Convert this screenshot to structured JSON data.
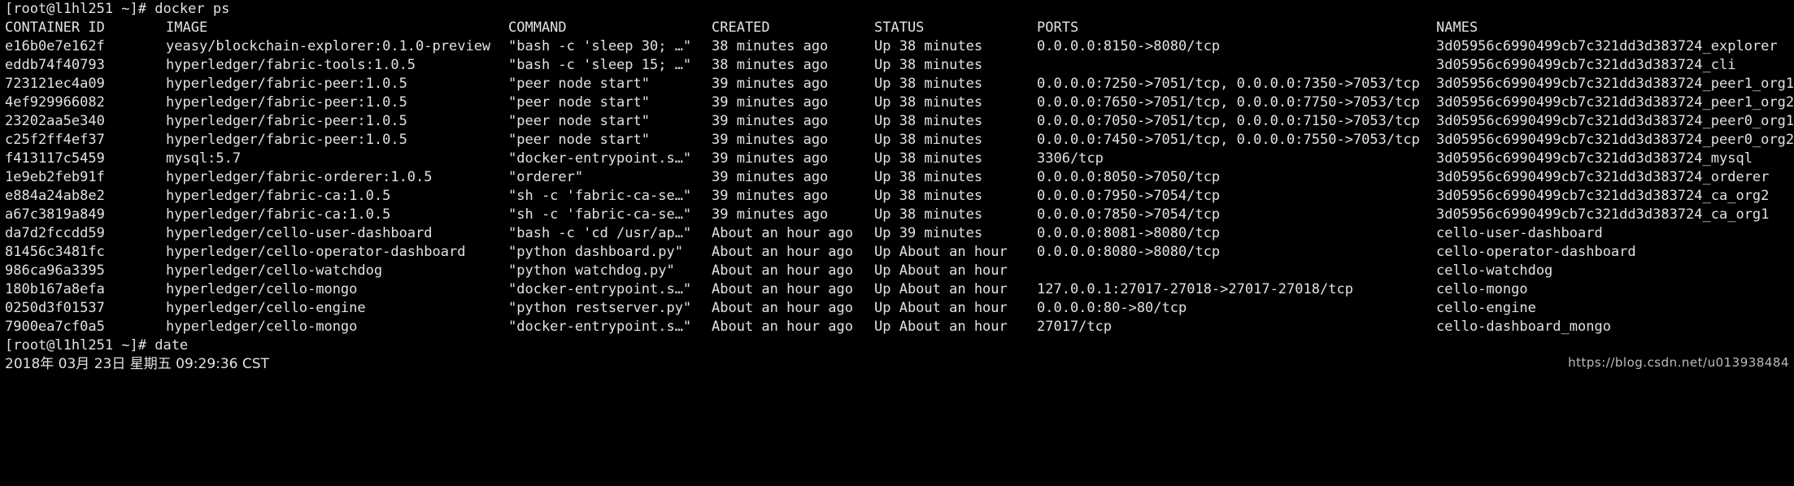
{
  "prompt1": "[root@l1hl251 ~]# docker ps",
  "headers": {
    "id": "CONTAINER ID",
    "image": "IMAGE",
    "command": "COMMAND",
    "created": "CREATED",
    "status": "STATUS",
    "ports": "PORTS",
    "names": "NAMES"
  },
  "rows": [
    {
      "id": "e16b0e7e162f",
      "image": "yeasy/blockchain-explorer:0.1.0-preview",
      "command": "\"bash -c 'sleep 30; …\"",
      "created": "38 minutes ago",
      "status": "Up 38 minutes",
      "ports": "0.0.0.0:8150->8080/tcp",
      "names": "3d05956c6990499cb7c321dd3d383724_explorer"
    },
    {
      "id": "eddb74f40793",
      "image": "hyperledger/fabric-tools:1.0.5",
      "command": "\"bash -c 'sleep 15; …\"",
      "created": "38 minutes ago",
      "status": "Up 38 minutes",
      "ports": "",
      "names": "3d05956c6990499cb7c321dd3d383724_cli"
    },
    {
      "id": "723121ec4a09",
      "image": "hyperledger/fabric-peer:1.0.5",
      "command": "\"peer node start\"",
      "created": "39 minutes ago",
      "status": "Up 38 minutes",
      "ports": "0.0.0.0:7250->7051/tcp, 0.0.0.0:7350->7053/tcp",
      "names": "3d05956c6990499cb7c321dd3d383724_peer1_org1"
    },
    {
      "id": "4ef929966082",
      "image": "hyperledger/fabric-peer:1.0.5",
      "command": "\"peer node start\"",
      "created": "39 minutes ago",
      "status": "Up 38 minutes",
      "ports": "0.0.0.0:7650->7051/tcp, 0.0.0.0:7750->7053/tcp",
      "names": "3d05956c6990499cb7c321dd3d383724_peer1_org2"
    },
    {
      "id": "23202aa5e340",
      "image": "hyperledger/fabric-peer:1.0.5",
      "command": "\"peer node start\"",
      "created": "39 minutes ago",
      "status": "Up 38 minutes",
      "ports": "0.0.0.0:7050->7051/tcp, 0.0.0.0:7150->7053/tcp",
      "names": "3d05956c6990499cb7c321dd3d383724_peer0_org1"
    },
    {
      "id": "c25f2ff4ef37",
      "image": "hyperledger/fabric-peer:1.0.5",
      "command": "\"peer node start\"",
      "created": "39 minutes ago",
      "status": "Up 38 minutes",
      "ports": "0.0.0.0:7450->7051/tcp, 0.0.0.0:7550->7053/tcp",
      "names": "3d05956c6990499cb7c321dd3d383724_peer0_org2"
    },
    {
      "id": "f413117c5459",
      "image": "mysql:5.7",
      "command": "\"docker-entrypoint.s…\"",
      "created": "39 minutes ago",
      "status": "Up 38 minutes",
      "ports": "3306/tcp",
      "names": "3d05956c6990499cb7c321dd3d383724_mysql"
    },
    {
      "id": "1e9eb2feb91f",
      "image": "hyperledger/fabric-orderer:1.0.5",
      "command": "\"orderer\"",
      "created": "39 minutes ago",
      "status": "Up 38 minutes",
      "ports": "0.0.0.0:8050->7050/tcp",
      "names": "3d05956c6990499cb7c321dd3d383724_orderer"
    },
    {
      "id": "e884a24ab8e2",
      "image": "hyperledger/fabric-ca:1.0.5",
      "command": "\"sh -c 'fabric-ca-se…\"",
      "created": "39 minutes ago",
      "status": "Up 38 minutes",
      "ports": "0.0.0.0:7950->7054/tcp",
      "names": "3d05956c6990499cb7c321dd3d383724_ca_org2"
    },
    {
      "id": "a67c3819a849",
      "image": "hyperledger/fabric-ca:1.0.5",
      "command": "\"sh -c 'fabric-ca-se…\"",
      "created": "39 minutes ago",
      "status": "Up 38 minutes",
      "ports": "0.0.0.0:7850->7054/tcp",
      "names": "3d05956c6990499cb7c321dd3d383724_ca_org1"
    },
    {
      "id": "da7d2fccdd59",
      "image": "hyperledger/cello-user-dashboard",
      "command": "\"bash -c 'cd /usr/ap…\"",
      "created": "About an hour ago",
      "status": "Up 39 minutes",
      "ports": "0.0.0.0:8081->8080/tcp",
      "names": "cello-user-dashboard"
    },
    {
      "id": "81456c3481fc",
      "image": "hyperledger/cello-operator-dashboard",
      "command": "\"python dashboard.py\"",
      "created": "About an hour ago",
      "status": "Up About an hour",
      "ports": "0.0.0.0:8080->8080/tcp",
      "names": "cello-operator-dashboard"
    },
    {
      "id": "986ca96a3395",
      "image": "hyperledger/cello-watchdog",
      "command": "\"python watchdog.py\"",
      "created": "About an hour ago",
      "status": "Up About an hour",
      "ports": "",
      "names": "cello-watchdog"
    },
    {
      "id": "180b167a8efa",
      "image": "hyperledger/cello-mongo",
      "command": "\"docker-entrypoint.s…\"",
      "created": "About an hour ago",
      "status": "Up About an hour",
      "ports": "127.0.0.1:27017-27018->27017-27018/tcp",
      "names": "cello-mongo"
    },
    {
      "id": "0250d3f01537",
      "image": "hyperledger/cello-engine",
      "command": "\"python restserver.py\"",
      "created": "About an hour ago",
      "status": "Up About an hour",
      "ports": "0.0.0.0:80->80/tcp",
      "names": "cello-engine"
    },
    {
      "id": "7900ea7cf0a5",
      "image": "hyperledger/cello-mongo",
      "command": "\"docker-entrypoint.s…\"",
      "created": "About an hour ago",
      "status": "Up About an hour",
      "ports": "27017/tcp",
      "names": "cello-dashboard_mongo"
    }
  ],
  "prompt2": "[root@l1hl251 ~]# date",
  "date_output": "2018年 03月 23日 星期五 09:29:36 CST",
  "watermark": "https://blog.csdn.net/u013938484"
}
